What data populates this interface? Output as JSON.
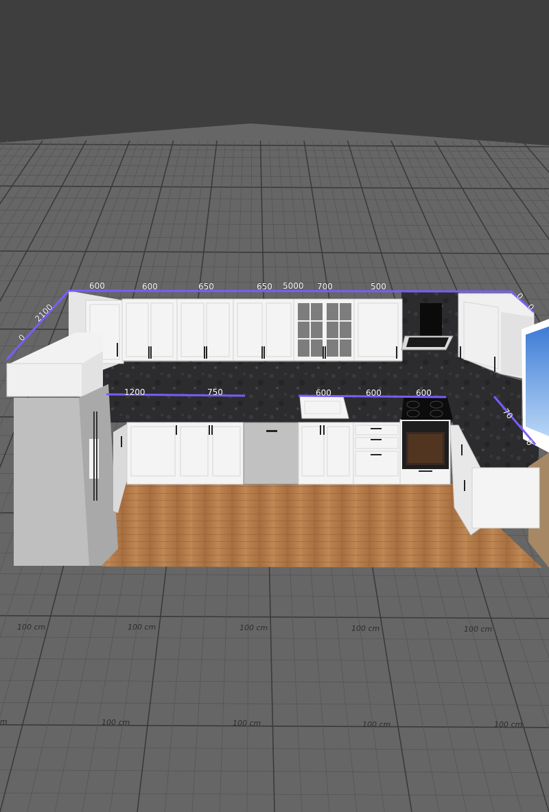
{
  "viewer": {
    "colors": {
      "background_top": "#3e3e3e",
      "floor": "#666666",
      "grid_line": "#555555",
      "grid_line_major": "#3a3a3a",
      "dimension_line": "#7a5cff",
      "cabinet": "#f2f2f2",
      "countertop": "#2a2a2c",
      "wood_floor": "#b27a4a",
      "appliance": "#b8b8b8"
    }
  },
  "dimensions": {
    "upper_back": [
      "600",
      "600",
      "650",
      "650",
      "5000",
      "700",
      "500"
    ],
    "left_upper": [
      "2100",
      "0"
    ],
    "right_upper": [
      "0",
      "0"
    ],
    "counter_left": [
      "1200",
      "750"
    ],
    "counter_right": [
      "600",
      "600",
      "600"
    ],
    "counter_side": [
      "70",
      "0"
    ]
  },
  "grid_labels": {
    "row1": [
      "100 cm",
      "100 cm",
      "100 cm",
      "100 cm",
      "100 cm"
    ],
    "row2": [
      "m",
      "100 cm",
      "100 cm",
      "100 cm",
      "100 cm"
    ]
  }
}
